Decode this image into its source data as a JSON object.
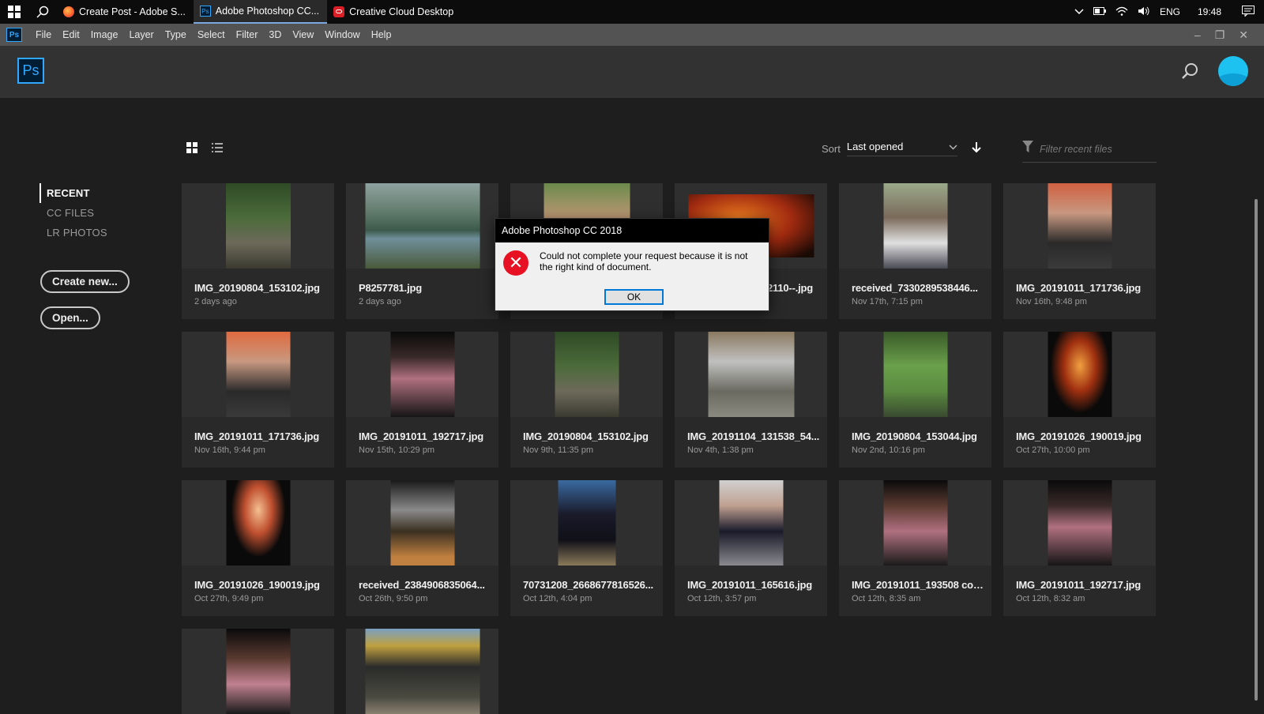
{
  "taskbar": {
    "tabs": [
      {
        "label": "Create Post - Adobe S...",
        "icon": "firefox-icon",
        "active": false
      },
      {
        "label": "Adobe Photoshop CC...",
        "icon": "photoshop-icon",
        "active": true
      },
      {
        "label": "Creative Cloud Desktop",
        "icon": "creative-cloud-icon",
        "active": false
      }
    ],
    "tray": {
      "language": "ENG",
      "time": "19:48"
    }
  },
  "menubar": {
    "app_icon": "Ps",
    "items": [
      "File",
      "Edit",
      "Image",
      "Layer",
      "Type",
      "Select",
      "Filter",
      "3D",
      "View",
      "Window",
      "Help"
    ]
  },
  "header": {
    "logo": "Ps"
  },
  "toolbar": {
    "sort_label": "Sort",
    "sort_value": "Last opened",
    "filter_placeholder": "Filter recent files"
  },
  "leftnav": {
    "items": [
      {
        "label": "RECENT",
        "active": true
      },
      {
        "label": "CC FILES",
        "active": false
      },
      {
        "label": "LR PHOTOS",
        "active": false
      }
    ],
    "create_new": "Create new...",
    "open": "Open..."
  },
  "files": [
    {
      "name": "IMG_20190804_153102.jpg",
      "date": "2 days ago"
    },
    {
      "name": "P8257781.jpg",
      "date": "2 days ago"
    },
    {
      "name": "",
      "date": ""
    },
    {
      "name": "2110--.jpg",
      "date": ""
    },
    {
      "name": "received_7330289538446...",
      "date": "Nov 17th, 7:15 pm"
    },
    {
      "name": "IMG_20191011_171736.jpg",
      "date": "Nov 16th, 9:48 pm"
    },
    {
      "name": "IMG_20191011_171736.jpg",
      "date": "Nov 16th, 9:44 pm"
    },
    {
      "name": "IMG_20191011_192717.jpg",
      "date": "Nov 15th, 10:29 pm"
    },
    {
      "name": "IMG_20190804_153102.jpg",
      "date": "Nov 9th, 11:35 pm"
    },
    {
      "name": "IMG_20191104_131538_54...",
      "date": "Nov 4th, 1:38 pm"
    },
    {
      "name": "IMG_20190804_153044.jpg",
      "date": "Nov 2nd, 10:16 pm"
    },
    {
      "name": "IMG_20191026_190019.jpg",
      "date": "Oct 27th, 10:00 pm"
    },
    {
      "name": "IMG_20191026_190019.jpg",
      "date": "Oct 27th, 9:49 pm"
    },
    {
      "name": "received_2384906835064...",
      "date": "Oct 26th, 9:50 pm"
    },
    {
      "name": "70731208_2668677816526...",
      "date": "Oct 12th, 4:04 pm"
    },
    {
      "name": "IMG_20191011_165616.jpg",
      "date": "Oct 12th, 3:57 pm"
    },
    {
      "name": "IMG_20191011_193508 cop...",
      "date": "Oct 12th, 8:35 am"
    },
    {
      "name": "IMG_20191011_192717.jpg",
      "date": "Oct 12th, 8:32 am"
    },
    {
      "name": "",
      "date": ""
    },
    {
      "name": "",
      "date": ""
    }
  ],
  "dialog": {
    "title": "Adobe Photoshop CC 2018",
    "message": "Could not complete your request because it is not the right kind of document.",
    "ok": "OK"
  },
  "colors": {
    "accent": "#31a8ff",
    "error": "#e81123"
  }
}
